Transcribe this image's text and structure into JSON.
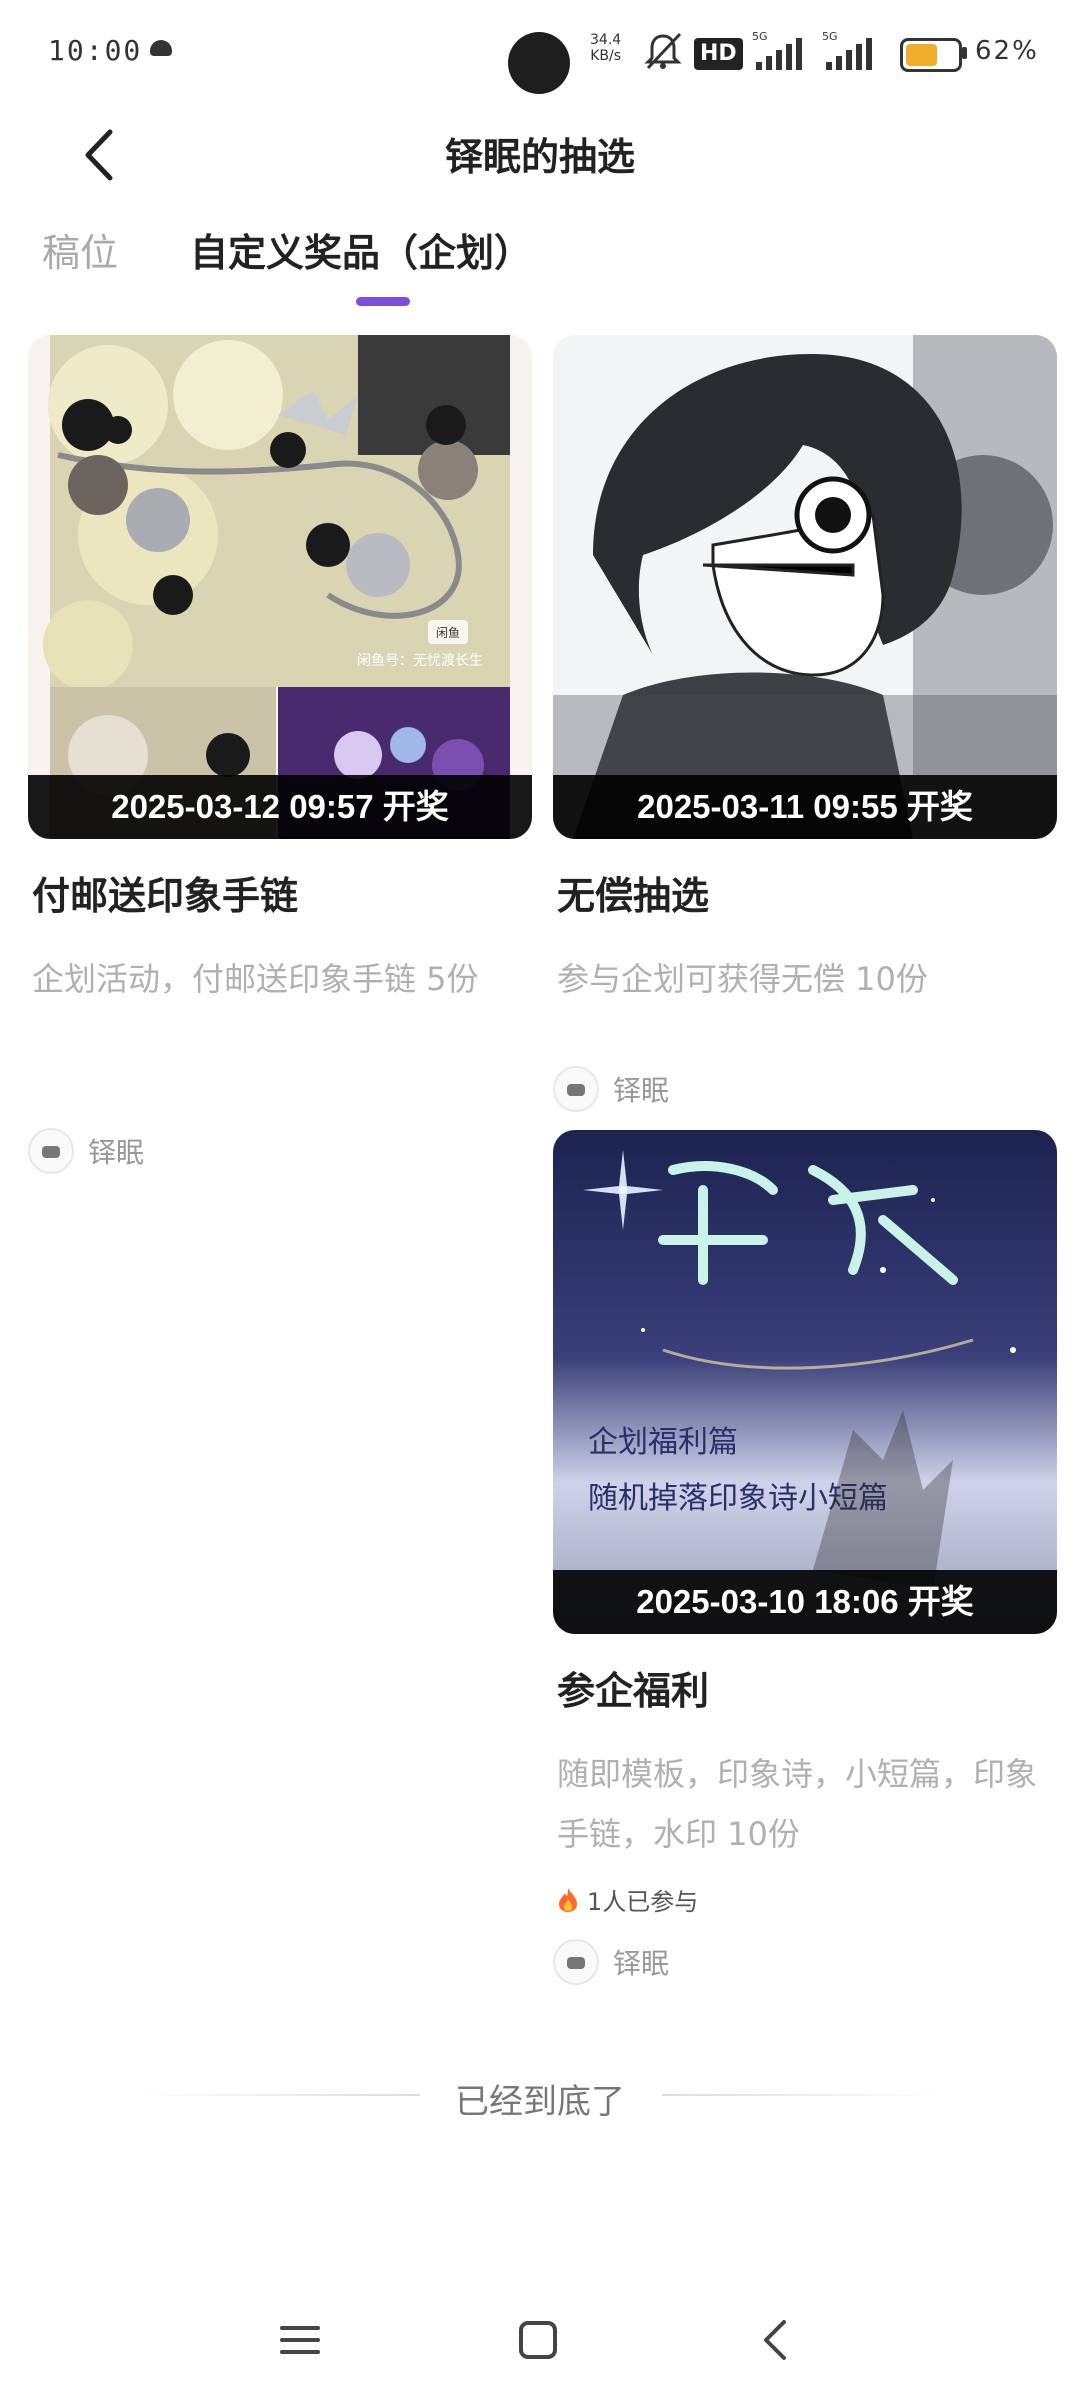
{
  "status_bar": {
    "time": "10:00",
    "net_speed_value": "34.4",
    "net_speed_unit": "KB/s",
    "hd_badge": "HD",
    "signal_1_label": "5G",
    "signal_2_label": "5G",
    "battery_percent": 62,
    "battery_text": "62%",
    "battery_color": "#f0ac2a"
  },
  "header": {
    "title": "铎眠的抽选",
    "back_icon": "chevron-left-icon"
  },
  "tabs": [
    {
      "label": "稿位",
      "active": false
    },
    {
      "label": "自定义奖品（企划）",
      "active": true
    }
  ],
  "accent_color": "#7c4fd8",
  "cards": [
    {
      "date": "2025-03-12 09:57 开奖",
      "title": "付邮送印象手链",
      "description": "企划活动，付邮送印象手链 5份",
      "participants": "",
      "author": "铎眠",
      "image_text_1": "闲鱼",
      "image_text_2": "闲鱼号：无忧渡长生"
    },
    {
      "date": "2025-03-11 09:55 开奖",
      "title": "无偿抽选",
      "description": "参与企划可获得无偿 10份",
      "participants": "",
      "author": "铎眠"
    },
    {
      "date": "2025-03-10 18:06 开奖",
      "title": "参企福利",
      "description": "随即模板，印象诗，小短篇，印象手链，水印 10份",
      "participants": "1人已参与",
      "author": "铎眠",
      "image_text_1": "企划福利篇",
      "image_text_2": "随机掉落印象诗小短篇"
    }
  ],
  "footer": {
    "end_text": "已经到底了"
  },
  "nav_bar": {
    "menu_icon": "menu-icon",
    "home_icon": "home-square-icon",
    "back_icon": "back-triangle-icon"
  }
}
